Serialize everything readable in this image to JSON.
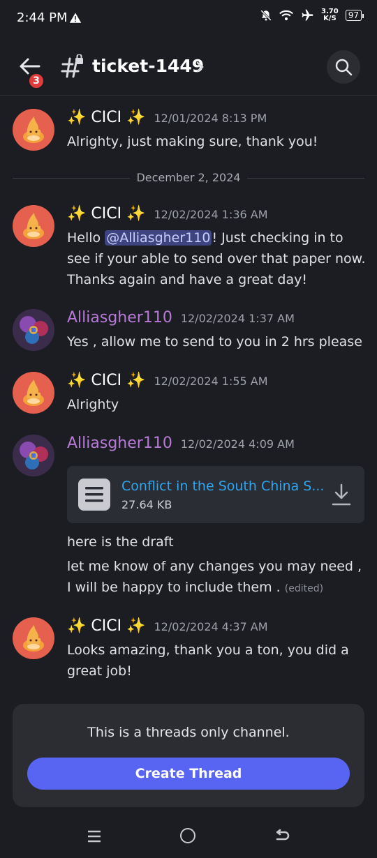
{
  "status_bar": {
    "time": "2:44 PM",
    "net_speed_value": "3.70",
    "net_speed_unit": "K/S",
    "battery": "97"
  },
  "header": {
    "unread_badge": "3",
    "channel_name": "ticket-1449"
  },
  "messages": [
    {
      "author": "✨ CICI ✨",
      "timestamp": "12/01/2024 8:13 PM",
      "text": "Alrighty, just making sure, thank you!"
    },
    {
      "author": "✨ CICI ✨",
      "timestamp": "12/02/2024 1:36 AM",
      "text_before": "Hello ",
      "mention": "@Alliasgher110",
      "text_after": "! Just checking in to see if your able to send over that paper now. Thanks again and have a great day!"
    },
    {
      "author": "Alliasgher110",
      "timestamp": "12/02/2024 1:37 AM",
      "text": "Yes , allow me to send to you in 2 hrs please"
    },
    {
      "author": "✨ CICI ✨",
      "timestamp": "12/02/2024 1:55 AM",
      "text": "Alrighty"
    },
    {
      "author": "Alliasgher110",
      "timestamp": "12/02/2024 4:09 AM",
      "attachment": {
        "name": "Conflict in the South China S...",
        "size": "27.64 KB"
      },
      "line1": "here is the draft",
      "line2": "let me know of any changes  you may need , I will be happy to include them . ",
      "edited": "(edited)"
    },
    {
      "author": "✨ CICI ✨",
      "timestamp": "12/02/2024 4:37 AM",
      "text": "Looks amazing, thank you a ton, you did a great job!"
    }
  ],
  "date_divider": "December 2, 2024",
  "threads_notice": {
    "text": "This is a threads only channel.",
    "button": "Create Thread"
  },
  "colors": {
    "background": "#1c1d22",
    "accent": "#5865f2",
    "mention_bg": "#3e4480",
    "link": "#2ea6f0",
    "username_alli": "#b67ad6",
    "cici_avatar": "#e5604f"
  }
}
